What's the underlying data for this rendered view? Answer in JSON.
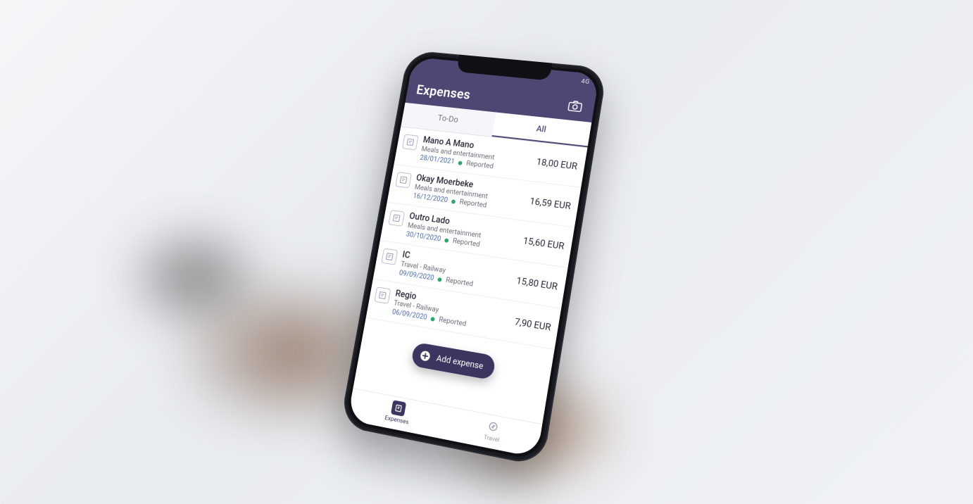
{
  "status_bar": {
    "network": "4G"
  },
  "header": {
    "title": "Expenses",
    "camera_icon": "camera"
  },
  "tabs": {
    "todo_label": "To-Do",
    "all_label": "All",
    "active": "all"
  },
  "expenses": [
    {
      "vendor": "Mano A Mano",
      "category": "Meals and entertainment",
      "date": "28/01/2021",
      "status": "Reported",
      "status_color": "#2fa36b",
      "amount": "18,00 EUR"
    },
    {
      "vendor": "Okay Moerbeke",
      "category": "Meals and entertainment",
      "date": "16/12/2020",
      "status": "Reported",
      "status_color": "#2fa36b",
      "amount": "16,59 EUR"
    },
    {
      "vendor": "Outro Lado",
      "category": "Meals and entertainment",
      "date": "30/10/2020",
      "status": "Reported",
      "status_color": "#2fa36b",
      "amount": "15,60 EUR"
    },
    {
      "vendor": "IC",
      "category": "Travel - Railway",
      "date": "09/09/2020",
      "status": "Reported",
      "status_color": "#2fa36b",
      "amount": "15,80 EUR"
    },
    {
      "vendor": "Regio",
      "category": "Travel - Railway",
      "date": "06/09/2020",
      "status": "Reported",
      "status_color": "#2fa36b",
      "amount": "7,90 EUR"
    }
  ],
  "fab": {
    "label": "Add expense"
  },
  "bottom_nav": {
    "expenses_label": "Expenses",
    "travel_label": "Travel"
  },
  "colors": {
    "primary": "#4c4773",
    "fab": "#3b3560"
  }
}
